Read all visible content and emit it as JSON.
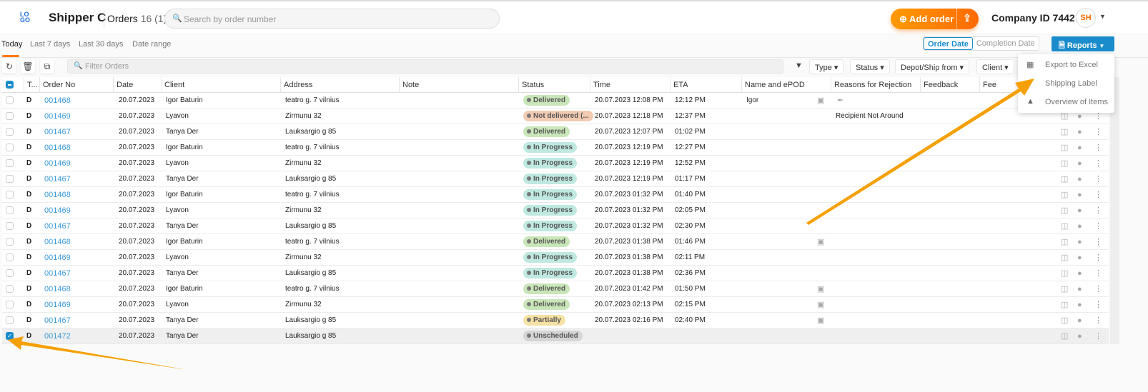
{
  "header": {
    "logo": "LOGO",
    "brand": "Shipper C",
    "orders_label": "Orders",
    "orders_count": "16 (1)",
    "search_placeholder": "Search by order number",
    "add_order": "Add order",
    "company": "Company ID 7442",
    "avatar": "SH"
  },
  "date_tabs": [
    "Today",
    "Last 7 days",
    "Last 30 days",
    "Date range"
  ],
  "date_toggle": {
    "order_date": "Order Date",
    "completion_date": "Completion Date"
  },
  "reports": {
    "label": "Reports",
    "menu": [
      "Export to Excel",
      "Shipping Label",
      "Overview of Items"
    ]
  },
  "toolbar": {
    "filter_placeholder": "Filter Orders",
    "filters": [
      "Type",
      "Status",
      "Depot/Ship from",
      "Client"
    ]
  },
  "columns": [
    "T...",
    "Order No",
    "Date",
    "Client",
    "Address",
    "Note",
    "Status",
    "Time",
    "ETA",
    "Name and ePOD",
    "Reasons for Rejection",
    "Feedback",
    "Fee"
  ],
  "rows": [
    {
      "t": "D",
      "no": "001468",
      "date": "20.07.2023",
      "client": "Igor Baturin",
      "address": "teatro g. 7 vilnius",
      "status": "Delivered",
      "sc": "st-delivered",
      "time": "20.07.2023 12:08 PM",
      "eta": "12:12 PM",
      "name": "Igor",
      "epod": 2,
      "reason": ""
    },
    {
      "t": "D",
      "no": "001469",
      "date": "20.07.2023",
      "client": "Lyavon",
      "address": "Zirmunu 32",
      "status": "Not delivered (...",
      "sc": "st-notdel",
      "time": "20.07.2023 12:18 PM",
      "eta": "12:37 PM",
      "name": "",
      "epod": 0,
      "reason": "Recipient Not Around"
    },
    {
      "t": "D",
      "no": "001467",
      "date": "20.07.2023",
      "client": "Tanya Der",
      "address": "Lauksargio g 85",
      "status": "Delivered",
      "sc": "st-delivered",
      "time": "20.07.2023 12:07 PM",
      "eta": "01:02 PM",
      "name": "",
      "epod": 0,
      "reason": ""
    },
    {
      "t": "D",
      "no": "001468",
      "date": "20.07.2023",
      "client": "Igor Baturin",
      "address": "teatro g. 7 vilnius",
      "status": "In Progress",
      "sc": "st-inprog",
      "time": "20.07.2023 12:19 PM",
      "eta": "12:27 PM",
      "name": "",
      "epod": 0,
      "reason": ""
    },
    {
      "t": "D",
      "no": "001469",
      "date": "20.07.2023",
      "client": "Lyavon",
      "address": "Zirmunu 32",
      "status": "In Progress",
      "sc": "st-inprog",
      "time": "20.07.2023 12:19 PM",
      "eta": "12:52 PM",
      "name": "",
      "epod": 0,
      "reason": ""
    },
    {
      "t": "D",
      "no": "001467",
      "date": "20.07.2023",
      "client": "Tanya Der",
      "address": "Lauksargio g 85",
      "status": "In Progress",
      "sc": "st-inprog",
      "time": "20.07.2023 12:19 PM",
      "eta": "01:17 PM",
      "name": "",
      "epod": 0,
      "reason": ""
    },
    {
      "t": "D",
      "no": "001468",
      "date": "20.07.2023",
      "client": "Igor Baturin",
      "address": "teatro g. 7 vilnius",
      "status": "In Progress",
      "sc": "st-inprog",
      "time": "20.07.2023 01:32 PM",
      "eta": "01:40 PM",
      "name": "",
      "epod": 0,
      "reason": ""
    },
    {
      "t": "D",
      "no": "001469",
      "date": "20.07.2023",
      "client": "Lyavon",
      "address": "Zirmunu 32",
      "status": "In Progress",
      "sc": "st-inprog",
      "time": "20.07.2023 01:32 PM",
      "eta": "02:05 PM",
      "name": "",
      "epod": 0,
      "reason": ""
    },
    {
      "t": "D",
      "no": "001467",
      "date": "20.07.2023",
      "client": "Tanya Der",
      "address": "Lauksargio g 85",
      "status": "In Progress",
      "sc": "st-inprog",
      "time": "20.07.2023 01:32 PM",
      "eta": "02:30 PM",
      "name": "",
      "epod": 0,
      "reason": ""
    },
    {
      "t": "D",
      "no": "001468",
      "date": "20.07.2023",
      "client": "Igor Baturin",
      "address": "teatro g. 7 vilnius",
      "status": "Delivered",
      "sc": "st-delivered",
      "time": "20.07.2023 01:38 PM",
      "eta": "01:46 PM",
      "name": "",
      "epod": 1,
      "reason": ""
    },
    {
      "t": "D",
      "no": "001469",
      "date": "20.07.2023",
      "client": "Lyavon",
      "address": "Zirmunu 32",
      "status": "In Progress",
      "sc": "st-inprog",
      "time": "20.07.2023 01:38 PM",
      "eta": "02:11 PM",
      "name": "",
      "epod": 0,
      "reason": ""
    },
    {
      "t": "D",
      "no": "001467",
      "date": "20.07.2023",
      "client": "Tanya Der",
      "address": "Lauksargio g 85",
      "status": "In Progress",
      "sc": "st-inprog",
      "time": "20.07.2023 01:38 PM",
      "eta": "02:36 PM",
      "name": "",
      "epod": 0,
      "reason": ""
    },
    {
      "t": "D",
      "no": "001468",
      "date": "20.07.2023",
      "client": "Igor Baturin",
      "address": "teatro g. 7 vilnius",
      "status": "Delivered",
      "sc": "st-delivered",
      "time": "20.07.2023 01:42 PM",
      "eta": "01:50 PM",
      "name": "",
      "epod": 1,
      "reason": ""
    },
    {
      "t": "D",
      "no": "001469",
      "date": "20.07.2023",
      "client": "Lyavon",
      "address": "Zirmunu 32",
      "status": "Delivered",
      "sc": "st-delivered",
      "time": "20.07.2023 02:13 PM",
      "eta": "02:15 PM",
      "name": "",
      "epod": 1,
      "reason": ""
    },
    {
      "t": "D",
      "no": "001467",
      "date": "20.07.2023",
      "client": "Tanya Der",
      "address": "Lauksargio g 85",
      "status": "Partially",
      "sc": "st-partial",
      "time": "20.07.2023 02:16 PM",
      "eta": "02:40 PM",
      "name": "",
      "epod": 1,
      "reason": ""
    },
    {
      "t": "D",
      "no": "001472",
      "date": "20.07.2023",
      "client": "Tanya Der",
      "address": "Lauksargio g 85",
      "status": "Unscheduled",
      "sc": "st-unsched",
      "time": "",
      "eta": "",
      "name": "",
      "epod": 0,
      "reason": "",
      "selected": true
    }
  ],
  "colors": {
    "accent": "#1a8ccc",
    "brand_orange": "#ff7a00",
    "annotation_arrow": "#f5a000"
  }
}
